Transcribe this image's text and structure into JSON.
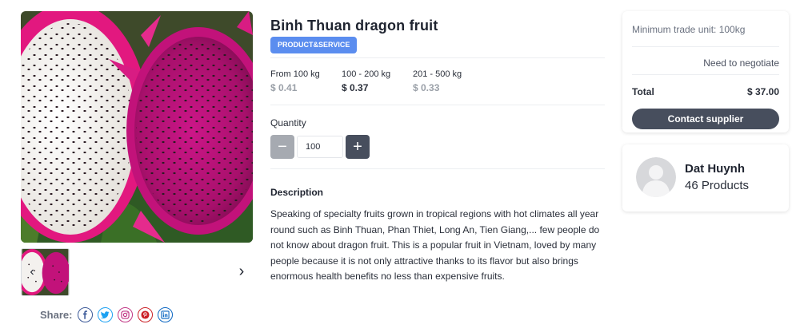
{
  "product": {
    "title": "Binh Thuan dragon fruit",
    "category": "PRODUCT&SERVICE",
    "image": "dragon-fruit-photo"
  },
  "gallery": {
    "prev_icon": "chevron-left-icon",
    "next_icon": "chevron-right-icon",
    "share_label": "Share:",
    "social": [
      "facebook-icon",
      "twitter-icon",
      "instagram-icon",
      "pinterest-icon",
      "linkedin-icon"
    ]
  },
  "pricing": {
    "tiers": [
      {
        "range": "From 100 kg",
        "price": "$ 0.41",
        "active": false
      },
      {
        "range": "100 - 200 kg",
        "price": "$ 0.37",
        "active": true
      },
      {
        "range": "201 - 500 kg",
        "price": "$ 0.33",
        "active": false
      }
    ]
  },
  "quantity": {
    "label": "Quantity",
    "value": "100",
    "minus": "−",
    "plus": "+"
  },
  "description": {
    "title": "Description",
    "text": "Speaking of specialty fruits grown in tropical regions with hot climates all year round such as Binh Thuan, Phan Thiet, Long An, Tien Giang,... few people do not know about dragon fruit. This is a popular fruit in Vietnam, loved by many people because it is not only attractive thanks to its flavor but also brings enormous health benefits no less than expensive fruits."
  },
  "trade": {
    "min_unit": "Minimum trade unit: 100kg",
    "negotiate": "Need to negotiate",
    "total_label": "Total",
    "total_value": "$ 37.00",
    "contact_label": "Contact supplier"
  },
  "supplier": {
    "name": "Dat Huynh",
    "products": "46 Products"
  },
  "colors": {
    "accent_badge": "#5b8def",
    "button_dark": "#474e5d",
    "button_light": "#a6aab1",
    "fruit_pink": "#d4208a"
  }
}
